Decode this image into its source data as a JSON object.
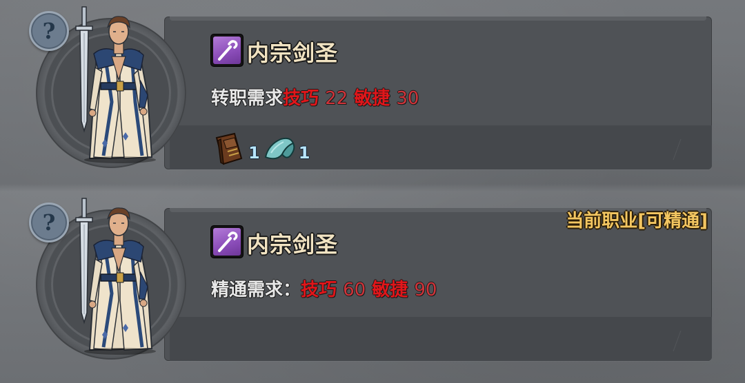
{
  "cards": [
    {
      "class_name": "内宗剑圣",
      "requirement_label": "转职需求",
      "stat1_name": "技巧",
      "stat1_value": "22",
      "stat2_name": "敏捷",
      "stat2_value": "30",
      "items": [
        {
          "icon": "book-icon",
          "count": "1"
        },
        {
          "icon": "cloth-icon",
          "count": "1"
        }
      ]
    },
    {
      "class_name": "内宗剑圣",
      "requirement_label": "精通需求：",
      "stat1_name": "技巧",
      "stat1_value": "60",
      "stat2_name": "敏捷",
      "stat2_value": "90",
      "status": "当前职业[可精通]"
    }
  ],
  "colors": {
    "class_icon_bg": "#8a4cb8",
    "class_name": "#f1e3c2",
    "stat_red": "#e0161a",
    "status_gold": "#f3c661",
    "item_count": "#b8e6ff"
  }
}
